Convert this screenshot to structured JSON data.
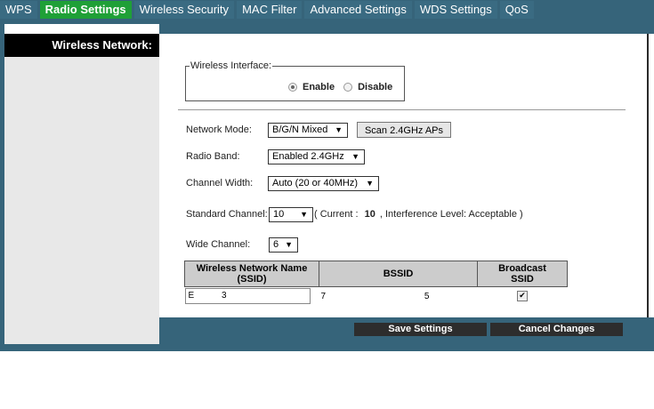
{
  "tabs": [
    {
      "label": "WPS",
      "active": false
    },
    {
      "label": "Radio Settings",
      "active": true
    },
    {
      "label": "Wireless Security",
      "active": false
    },
    {
      "label": "MAC Filter",
      "active": false
    },
    {
      "label": "Advanced Settings",
      "active": false
    },
    {
      "label": "WDS Settings",
      "active": false
    },
    {
      "label": "QoS",
      "active": false
    }
  ],
  "sidebar": {
    "title": "Wireless Network:"
  },
  "wireless_interface": {
    "legend": "Wireless Interface:",
    "options": [
      {
        "label": "Enable",
        "selected": true
      },
      {
        "label": "Disable",
        "selected": false
      }
    ]
  },
  "form": {
    "network_mode": {
      "label": "Network Mode:",
      "value": "B/G/N Mixed"
    },
    "scan_button": "Scan 2.4GHz APs",
    "radio_band": {
      "label": "Radio Band:",
      "value": "Enabled 2.4GHz"
    },
    "channel_width": {
      "label": "Channel Width:",
      "value": "Auto (20 or 40MHz)"
    },
    "standard_channel": {
      "label": "Standard Channel:",
      "value": "10",
      "current_prefix": "( Current :",
      "current_value": "10",
      "interference_text": ", Interference Level: Acceptable )"
    },
    "wide_channel": {
      "label": "Wide Channel:",
      "value": "6"
    }
  },
  "ssid_table": {
    "headers": {
      "ssid_line1": "Wireless Network Name",
      "ssid_line2": "(SSID)",
      "bssid": "BSSID",
      "broadcast_line1": "Broadcast",
      "broadcast_line2": "SSID"
    },
    "rows": [
      {
        "ssid_a": "E",
        "ssid_b": "3",
        "bssid_a": "7",
        "bssid_b": "5",
        "broadcast": true
      }
    ]
  },
  "footer": {
    "save": "Save Settings",
    "cancel": "Cancel Changes"
  },
  "colors": {
    "frame": "#36647a",
    "active_tab": "#1fa037",
    "sidebar_header": "#000000",
    "footer_button": "#2d2d2d"
  }
}
